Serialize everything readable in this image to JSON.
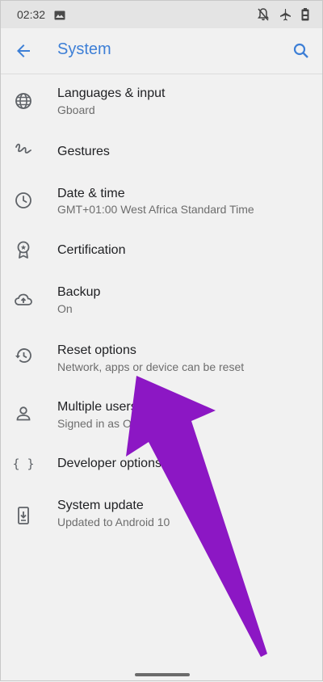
{
  "status_bar": {
    "time": "02:32",
    "icons": [
      "image-icon",
      "notifications-off-icon",
      "airplane-icon",
      "battery-icon"
    ]
  },
  "app_bar": {
    "title": "System",
    "back_icon": "arrow-back-icon",
    "search_icon": "search-icon",
    "accent": "#3d7fd6"
  },
  "items": [
    {
      "label": "Languages & input",
      "sub": "Gboard",
      "icon": "globe-icon"
    },
    {
      "label": "Gestures",
      "sub": "",
      "icon": "gesture-icon"
    },
    {
      "label": "Date & time",
      "sub": "GMT+01:00 West Africa Standard Time",
      "icon": "clock-icon"
    },
    {
      "label": "Certification",
      "sub": "",
      "icon": "certification-icon"
    },
    {
      "label": "Backup",
      "sub": "On",
      "icon": "cloud-upload-icon"
    },
    {
      "label": "Reset options",
      "sub": "Network, apps or device can be reset",
      "icon": "history-icon"
    },
    {
      "label": "Multiple users",
      "sub": "Signed in as Ola",
      "icon": "person-icon"
    },
    {
      "label": "Developer options",
      "sub": "",
      "icon": "code-braces-icon"
    },
    {
      "label": "System update",
      "sub": "Updated to Android 10",
      "icon": "system-update-icon"
    }
  ],
  "annotation": {
    "arrow_color": "#8c17c4"
  }
}
